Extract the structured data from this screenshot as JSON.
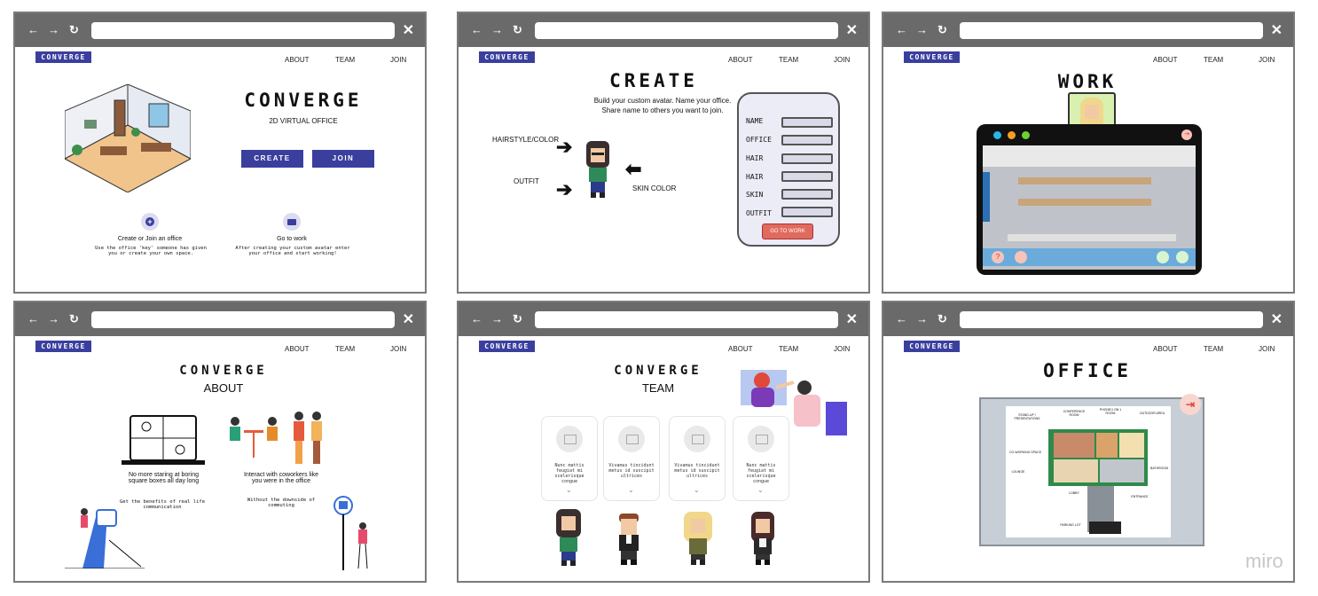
{
  "brand": "CONVERGE",
  "menu": {
    "about": "ABOUT",
    "team": "TEAM",
    "join": "JOIN"
  },
  "nav": {
    "back": "←",
    "forward": "→",
    "reload": "↻",
    "close": "✕"
  },
  "home": {
    "title": "CONVERGE",
    "subtitle": "2D VIRTUAL OFFICE",
    "create_label": "CREATE",
    "join_label": "JOIN",
    "feature1_title": "Create or Join an office",
    "feature1_desc": "Use the office 'key' someone has given you or create your own space.",
    "feature2_title": "Go to work",
    "feature2_desc": "After creating your custom avatar enter your office and start working!"
  },
  "create": {
    "title": "CREATE",
    "desc_line1": "Build your custom avatar.  Name your office.",
    "desc_line2": "Share name to others you want to join.",
    "label_hair": "HAIRSTYLE/COLOR",
    "label_outfit": "OUTFIT",
    "label_skin": "SKIN COLOR",
    "fields": [
      "NAME",
      "OFFICE",
      "HAIR",
      "HAIR",
      "SKIN",
      "OUTFIT"
    ],
    "go_label": "GO TO WORK"
  },
  "work": {
    "title": "WORK"
  },
  "about": {
    "title": "CONVERGE",
    "subtitle": "ABOUT",
    "left_caption": "No more staring at boring square boxes all day long",
    "right_caption": "Interact with coworkers like you were in the office",
    "left_sub": "Get the benefits of real life communication",
    "right_sub": "Without the downside of commuting"
  },
  "team": {
    "title": "CONVERGE",
    "subtitle": "TEAM",
    "cards": [
      "Nunc mattis feugiat mi scelerisque congue",
      "Vivamus tincidunt metus id suscipit ultrices",
      "Vivamus tincidunt metus id suscipit ultrices",
      "Nunc mattis feugiat mi scelerisque congue"
    ]
  },
  "office": {
    "title": "OFFICE",
    "map_labels": [
      "STAND-UP / PRESENTATIONS",
      "CONFERENCE ROOM",
      "PHONE/1 ON 1 ROOM",
      "OUTDOOR AREA",
      "CO-WORKING SPACE",
      "LOUNGE",
      "BATHROOM",
      "LOBBY",
      "ENTRANCE",
      "PARKING LOT"
    ]
  },
  "watermark": "miro",
  "colors": {
    "accent": "#3a3f9e",
    "go_button": "#e06a5e",
    "frame_bar": "#6a6a6a"
  }
}
